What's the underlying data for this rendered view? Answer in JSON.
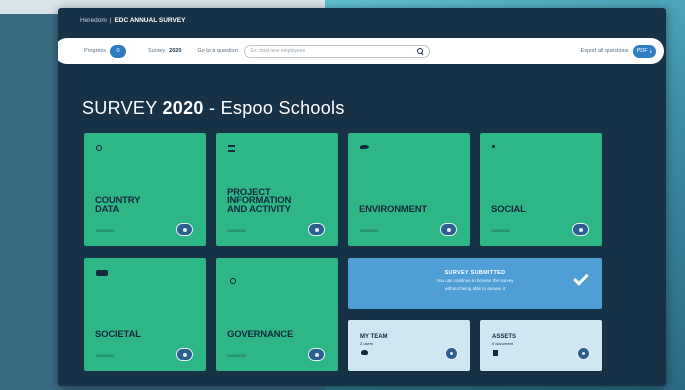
{
  "breadcrumb": {
    "home": "Heredom",
    "separator": "|",
    "section": "EDC ANNUAL SURVEY"
  },
  "toolbar": {
    "progress_label": "Progress",
    "progress_value": "0",
    "survey_label": "Survey",
    "survey_year": "2020",
    "goto_label": "Go to a question",
    "search_placeholder": "Ex: total new employees",
    "export_label": "Export all questions",
    "export_button": "PDF"
  },
  "page": {
    "title_prefix": "SURVEY",
    "title_year": "2020",
    "title_suffix": "- Espoo Schools"
  },
  "tiles": [
    {
      "label_lines": [
        "COUNTRY",
        "DATA"
      ],
      "sub": "1000/5000",
      "icon": "info-icon",
      "color": "#2fb687"
    },
    {
      "label_lines": [
        "PROJECT",
        "INFORMATION",
        "AND ACTIVITY"
      ],
      "sub": "1000/5000",
      "icon": "document-icon",
      "color": "#2fb687"
    },
    {
      "label_lines": [
        "ENVIRONMENT"
      ],
      "sub": "1000/5000",
      "icon": "leaf-icon",
      "color": "#2fb687"
    },
    {
      "label_lines": [
        "SOCIAL"
      ],
      "sub": "1000/5000",
      "icon": "people-icon",
      "color": "#2fb687"
    },
    {
      "label_lines": [
        "SOCIETAL"
      ],
      "sub": "1000/5000",
      "icon": "speech-icon",
      "color": "#2fb687"
    },
    {
      "label_lines": [
        "GOVERNANCE"
      ],
      "sub": "1000/5000",
      "icon": "governance-icon",
      "color": "#2fb687"
    }
  ],
  "submitted": {
    "heading": "SURVEY SUBMITTED",
    "line1": "You can continue to browse the survey",
    "line2": "without being able to answer it"
  },
  "my_team": {
    "heading": "MY TEAM",
    "sub": "2 users"
  },
  "assets": {
    "heading": "ASSETS",
    "sub": "0 document"
  },
  "colors": {
    "accent": "#2e7cc1",
    "tile": "#2fb687",
    "submitted": "#4f9ed6",
    "frame": "#173147"
  }
}
